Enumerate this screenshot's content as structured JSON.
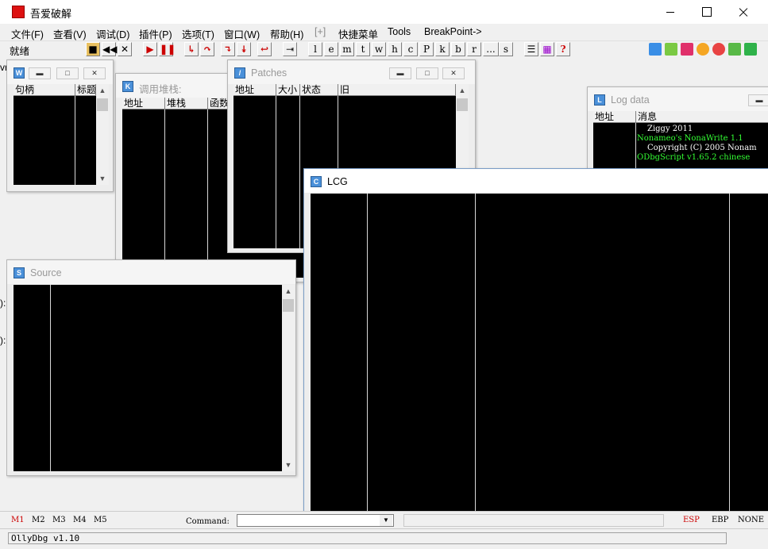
{
  "app": {
    "title": "吾爱破解"
  },
  "menu": [
    {
      "label": "文件(F)",
      "dim": false
    },
    {
      "label": "查看(V)",
      "dim": false
    },
    {
      "label": "调试(D)",
      "dim": false
    },
    {
      "label": "插件(P)",
      "dim": false
    },
    {
      "label": "选项(T)",
      "dim": false
    },
    {
      "label": "窗口(W)",
      "dim": false
    },
    {
      "label": "帮助(H)",
      "dim": false
    },
    {
      "label": "[+]",
      "dim": true
    },
    {
      "label": "快捷菜单",
      "dim": false
    },
    {
      "label": "Tools",
      "dim": false
    },
    {
      "label": "BreakPoint->",
      "dim": false
    }
  ],
  "toolbar": {
    "status": "就绪",
    "letter_buttons": [
      "l",
      "e",
      "m",
      "t",
      "w",
      "h",
      "c",
      "P",
      "k",
      "b",
      "r",
      "...",
      "s"
    ],
    "help_label": "?"
  },
  "windows": {
    "w": {
      "icon": "W",
      "cols": [
        "句柄",
        "标题"
      ]
    },
    "callstack": {
      "icon": "K",
      "title": "调用堆栈:",
      "cols": [
        "地址",
        "堆栈",
        "函数"
      ]
    },
    "patches": {
      "icon": "/",
      "title": "Patches",
      "cols": [
        "地址",
        "大小",
        "状态",
        "旧"
      ]
    },
    "log": {
      "icon": "L",
      "title": "Log data",
      "cols": [
        "地址",
        "消息"
      ],
      "lines": [
        {
          "text": "Ziggy 2011",
          "color": "#ffffff"
        },
        {
          "text": "Nonameo's NonaWrite 1.1",
          "color": "#33ff33"
        },
        {
          "text": "Copyright (C) 2005 Nonam",
          "color": "#ffffff"
        },
        {
          "text": "ODbgScript v1.65.2 chinese",
          "color": "#33ff33"
        }
      ]
    },
    "source": {
      "icon": "S",
      "title": "Source"
    },
    "lcg": {
      "icon": "C",
      "title": "LCG"
    }
  },
  "bottom": {
    "mbuttons": [
      "M1",
      "M2",
      "M3",
      "M4",
      "M5"
    ],
    "command_label": "Command:",
    "command_value": "",
    "regs": [
      "ESP",
      "EBP",
      "NONE"
    ]
  },
  "statusbar": {
    "version": "OllyDbg v1.10"
  },
  "side_fragments": [
    "vn",
    "):",
    "):"
  ]
}
